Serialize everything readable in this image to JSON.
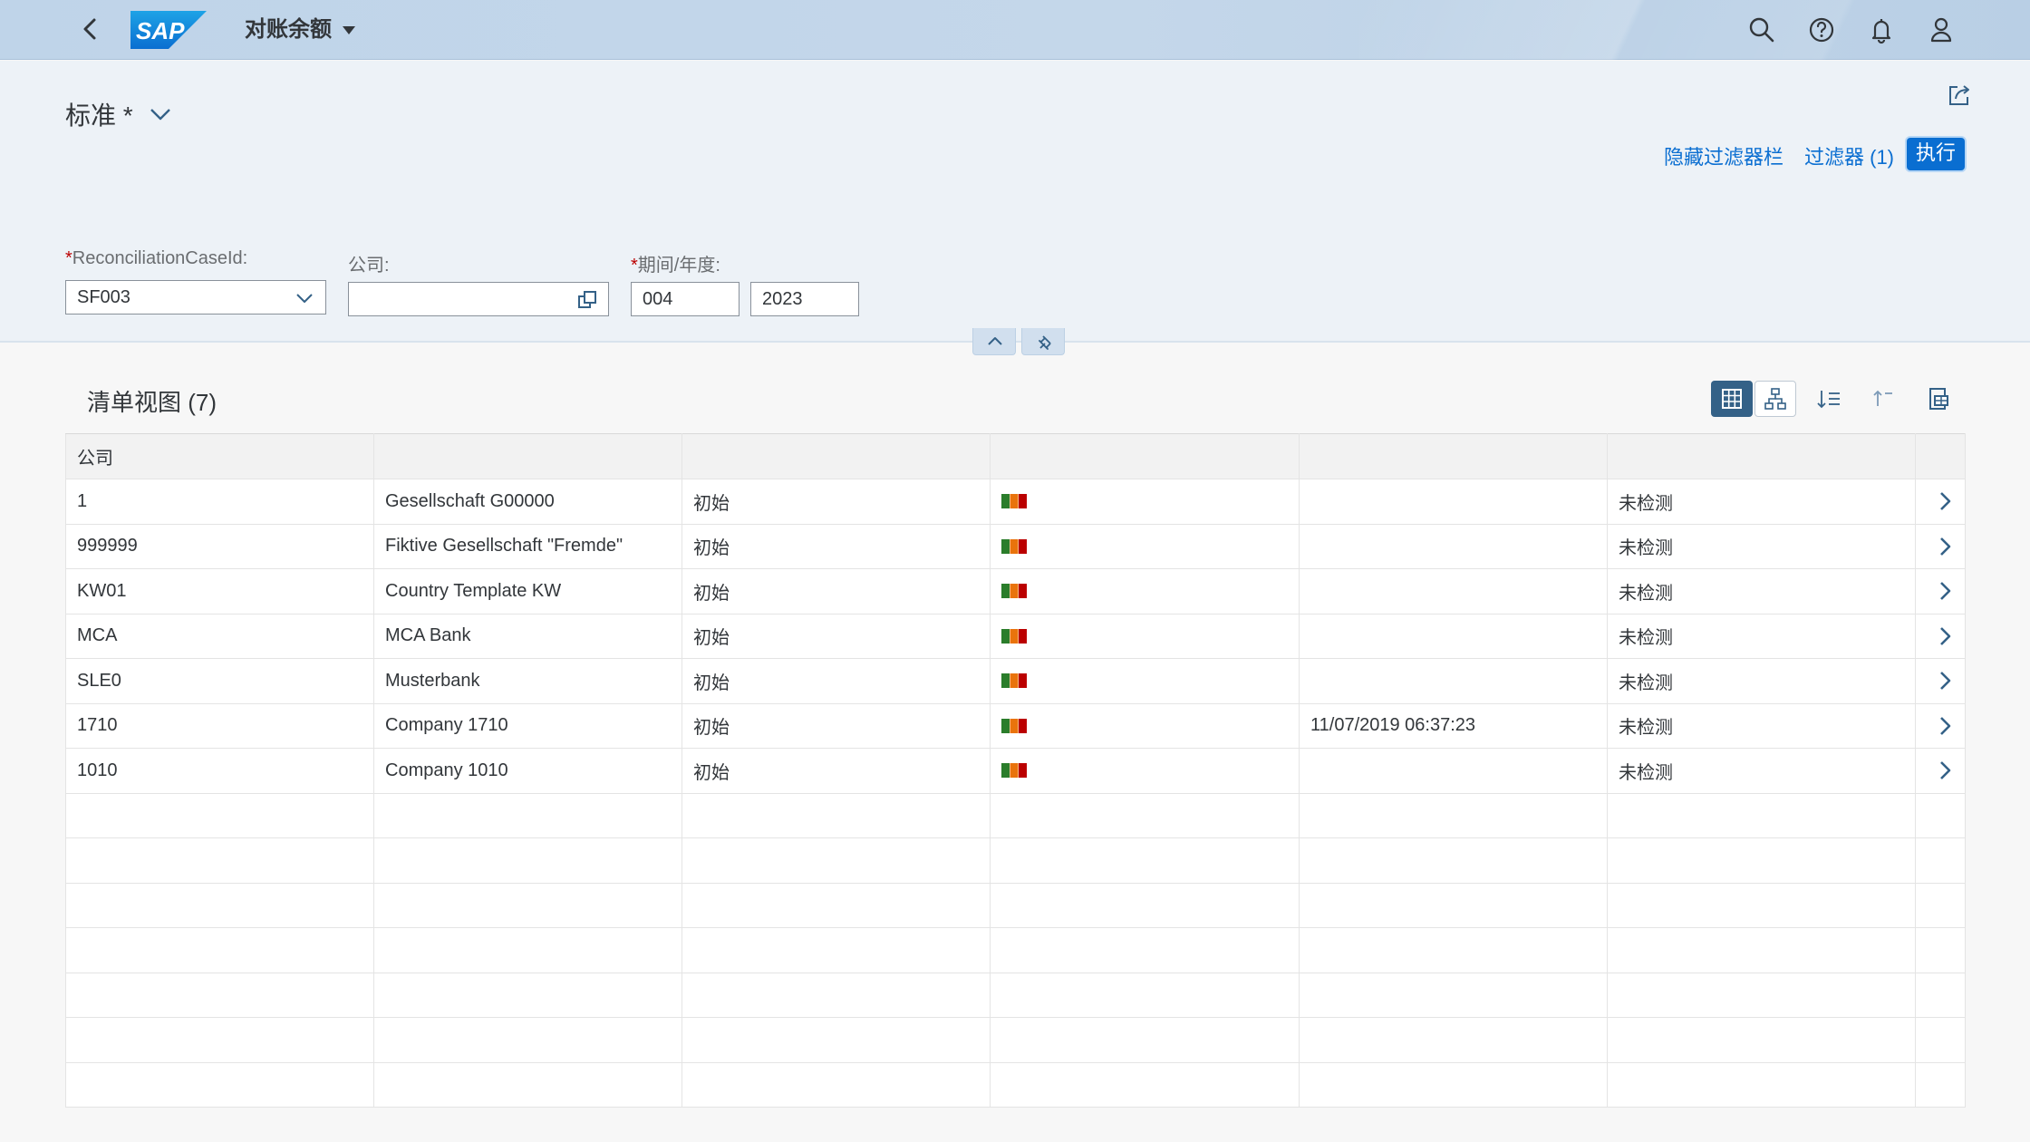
{
  "shell": {
    "title": "对账余额",
    "logo_text": "SAP",
    "icons": [
      "back-icon",
      "search-icon",
      "help-icon",
      "notifications-icon",
      "user-icon"
    ]
  },
  "header": {
    "variant_label": "标准 *",
    "hide_filter_bar": "隐藏过滤器栏",
    "filters_link": "过滤器 (1)",
    "go_button": "执行"
  },
  "filters": {
    "reconciliation_case": {
      "required_mark": "*",
      "label": "ReconciliationCaseId:",
      "value": "SF003"
    },
    "company": {
      "label": "公司:",
      "value": ""
    },
    "period_year": {
      "required_mark": "*",
      "label": "期间/年度:",
      "period": "004",
      "year": "2023"
    }
  },
  "list": {
    "title": "清单视图 (7)",
    "columns": [
      "公司",
      "",
      "",
      "",
      "",
      "",
      ""
    ],
    "rows": [
      {
        "company": "1",
        "name": "Gesellschaft G00000",
        "status": "初始",
        "datetime": "",
        "check": "未检测"
      },
      {
        "company": "999999",
        "name": "Fiktive Gesellschaft \"Fremde\"",
        "status": "初始",
        "datetime": "",
        "check": "未检测"
      },
      {
        "company": "KW01",
        "name": "Country Template KW",
        "status": "初始",
        "datetime": "",
        "check": "未检测"
      },
      {
        "company": "MCA",
        "name": "MCA Bank",
        "status": "初始",
        "datetime": "",
        "check": "未检测"
      },
      {
        "company": "SLE0",
        "name": "Musterbank",
        "status": "初始",
        "datetime": "",
        "check": "未检测"
      },
      {
        "company": "1710",
        "name": "Company 1710",
        "status": "初始",
        "datetime": "11/07/2019 06:37:23",
        "check": "未检测"
      },
      {
        "company": "1010",
        "name": "Company 1010",
        "status": "初始",
        "datetime": "",
        "check": "未检测"
      }
    ],
    "empty_rows": 7
  },
  "colors": {
    "accent": "#0a6ed1",
    "shell_bg": "#c4d7ea",
    "header_bg": "#edf2f7",
    "status_bar": [
      "#2b7d2b",
      "#e9730c",
      "#bb0000"
    ]
  }
}
